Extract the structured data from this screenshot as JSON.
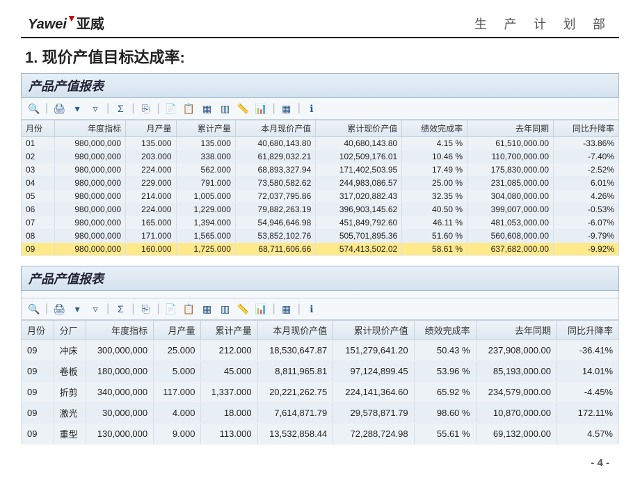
{
  "brand": {
    "en": "Yawei",
    "cn": "亚威"
  },
  "department": "生 产 计 划 部",
  "section_title": "1. 现价产值目标达成率:",
  "page_number": "- 4 -",
  "panel_title": "产品产值报表",
  "toolbar_icons": [
    "search",
    "print",
    "filter-asc",
    "filter",
    "sum",
    "copy",
    "doc",
    "paste",
    "layout",
    "cols",
    "ruler",
    "chart",
    "table",
    "info"
  ],
  "table1": {
    "headers": [
      "月份",
      "年度指标",
      "月产量",
      "累计产量",
      "本月现价产值",
      "累计现价产值",
      "绩效完成率",
      "去年同期",
      "同比升降率"
    ],
    "rows": [
      [
        "01",
        "980,000,000",
        "135.000",
        "135.000",
        "40,680,143.80",
        "40,680,143.80",
        "4.15 %",
        "61,510,000.00",
        "-33.86%"
      ],
      [
        "02",
        "980,000,000",
        "203.000",
        "338.000",
        "61,829,032.21",
        "102,509,176.01",
        "10.46 %",
        "110,700,000.00",
        "-7.40%"
      ],
      [
        "03",
        "980,000,000",
        "224.000",
        "562.000",
        "68,893,327.94",
        "171,402,503.95",
        "17.49 %",
        "175,830,000.00",
        "-2.52%"
      ],
      [
        "04",
        "980,000,000",
        "229.000",
        "791.000",
        "73,580,582.62",
        "244,983,086.57",
        "25.00 %",
        "231,085,000.00",
        "6.01%"
      ],
      [
        "05",
        "980,000,000",
        "214.000",
        "1,005.000",
        "72,037,795.86",
        "317,020,882.43",
        "32.35 %",
        "304,080,000.00",
        "4.26%"
      ],
      [
        "06",
        "980,000,000",
        "224.000",
        "1,229.000",
        "79,882,263.19",
        "396,903,145.62",
        "40.50 %",
        "399,007,000.00",
        "-0.53%"
      ],
      [
        "07",
        "980,000,000",
        "165.000",
        "1,394.000",
        "54,946,646.98",
        "451,849,792.60",
        "46.11 %",
        "481,053,000.00",
        "-6.07%"
      ],
      [
        "08",
        "980,000,000",
        "171.000",
        "1,565.000",
        "53,852,102.76",
        "505,701,895.36",
        "51.60 %",
        "560,608,000.00",
        "-9.79%"
      ],
      [
        "09",
        "980,000,000",
        "160.000",
        "1,725.000",
        "68,711,606.66",
        "574,413,502.02",
        "58.61 %",
        "637,682,000.00",
        "-9.92%"
      ]
    ],
    "highlight_row": 8
  },
  "table2": {
    "headers": [
      "月份",
      "分厂",
      "年度指标",
      "月产量",
      "累计产量",
      "本月现价产值",
      "累计现价产值",
      "绩效完成率",
      "去年同期",
      "同比升降率"
    ],
    "rows": [
      [
        "09",
        "冲床",
        "300,000,000",
        "25.000",
        "212.000",
        "18,530,647.87",
        "151,279,641.20",
        "50.43 %",
        "237,908,000.00",
        "-36.41%"
      ],
      [
        "09",
        "卷板",
        "180,000,000",
        "5.000",
        "45.000",
        "8,811,965.81",
        "97,124,899.45",
        "53.96 %",
        "85,193,000.00",
        "14.01%"
      ],
      [
        "09",
        "折剪",
        "340,000,000",
        "117.000",
        "1,337.000",
        "20,221,262.75",
        "224,141,364.60",
        "65.92 %",
        "234,579,000.00",
        "-4.45%"
      ],
      [
        "09",
        "激光",
        "30,000,000",
        "4.000",
        "18.000",
        "7,614,871.79",
        "29,578,871.79",
        "98.60 %",
        "10,870,000.00",
        "172.11%"
      ],
      [
        "09",
        "重型",
        "130,000,000",
        "9.000",
        "113.000",
        "13,532,858.44",
        "72,288,724.98",
        "55.61 %",
        "69,132,000.00",
        "4.57%"
      ]
    ]
  }
}
